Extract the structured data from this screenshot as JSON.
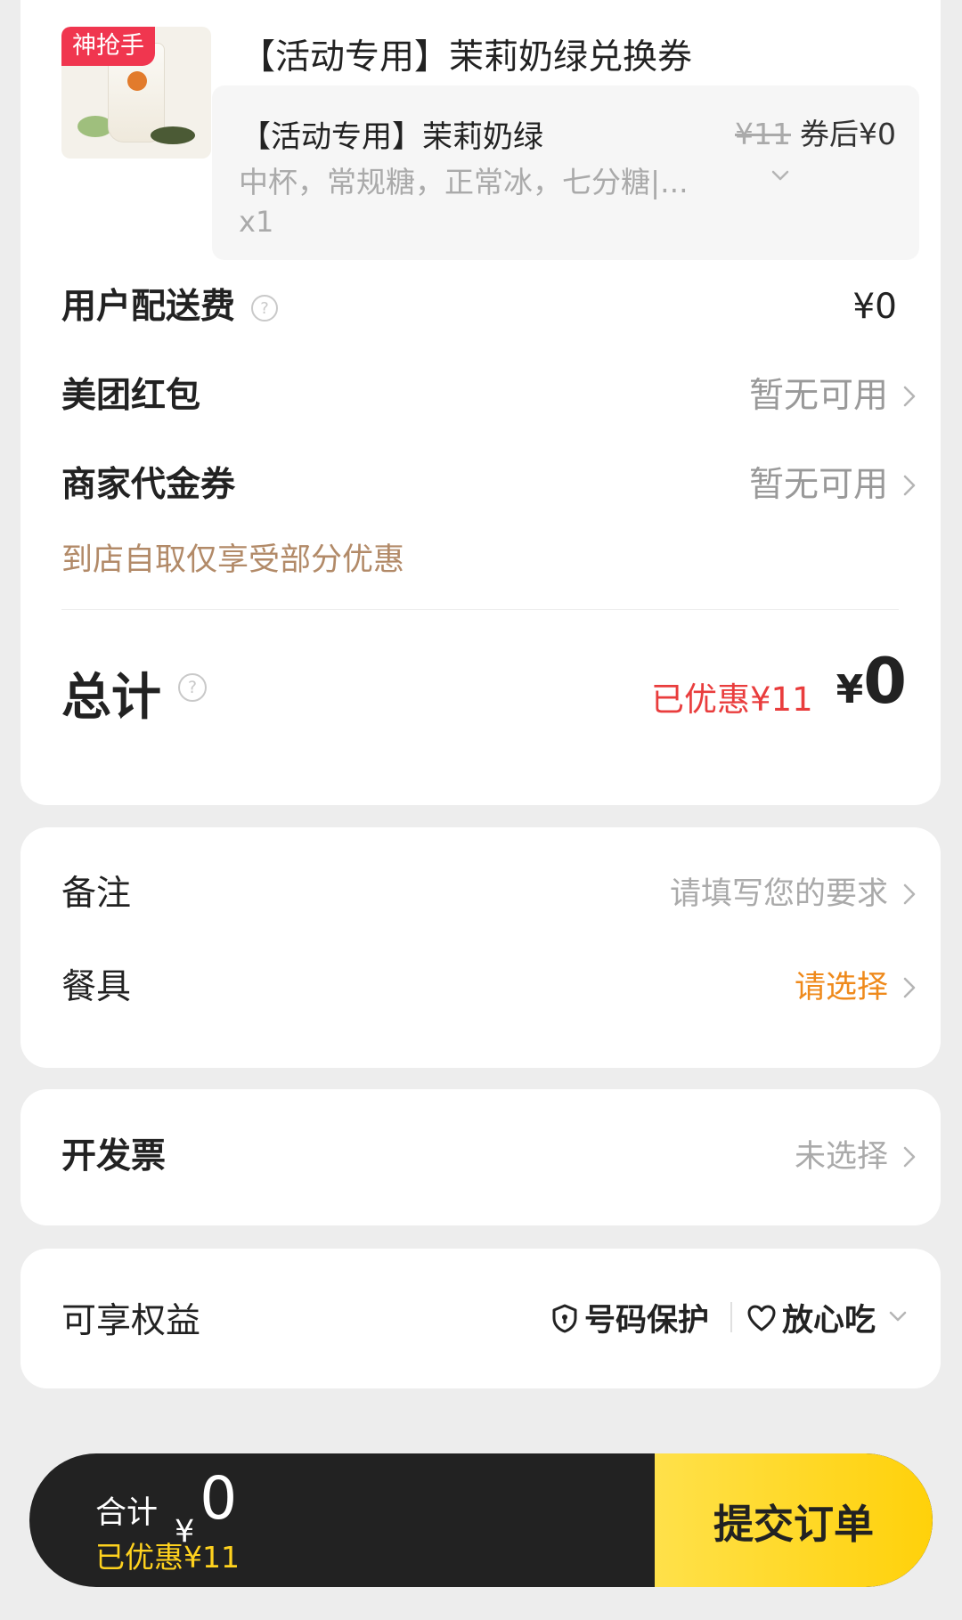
{
  "product": {
    "badge": "神抢手",
    "title": "【活动专用】茉莉奶绿兑换券",
    "sku": {
      "name": "【活动专用】茉莉奶绿",
      "original_price": "¥11",
      "after_coupon_label": "券后¥0",
      "specs": "中杯，常规糖，正常冰，七分糖|...",
      "quantity": "x1"
    }
  },
  "fees": {
    "delivery": {
      "label": "用户配送费",
      "value": "¥0"
    },
    "meituan_redpack": {
      "label": "美团红包",
      "value": "暂无可用"
    },
    "merchant_voucher": {
      "label": "商家代金券",
      "value": "暂无可用"
    },
    "pickup_note": "到店自取仅享受部分优惠"
  },
  "total": {
    "label": "总计",
    "discount": "已优惠¥11",
    "currency": "¥",
    "amount": "0"
  },
  "notes": {
    "remark": {
      "label": "备注",
      "placeholder": "请填写您的要求"
    },
    "tableware": {
      "label": "餐具",
      "value": "请选择"
    }
  },
  "invoice": {
    "label": "开发票",
    "value": "未选择"
  },
  "benefits": {
    "label": "可享权益",
    "items": [
      "号码保护",
      "放心吃"
    ]
  },
  "bottom_bar": {
    "total_label": "合计",
    "currency": "¥",
    "amount": "0",
    "discount": "已优惠¥11",
    "submit_label": "提交订单"
  },
  "colors": {
    "accent_yellow": "#ffd10a",
    "discount_red": "#e93d3d",
    "tableware_orange": "#ef8a1c",
    "pickup_brown": "#b28a68"
  }
}
